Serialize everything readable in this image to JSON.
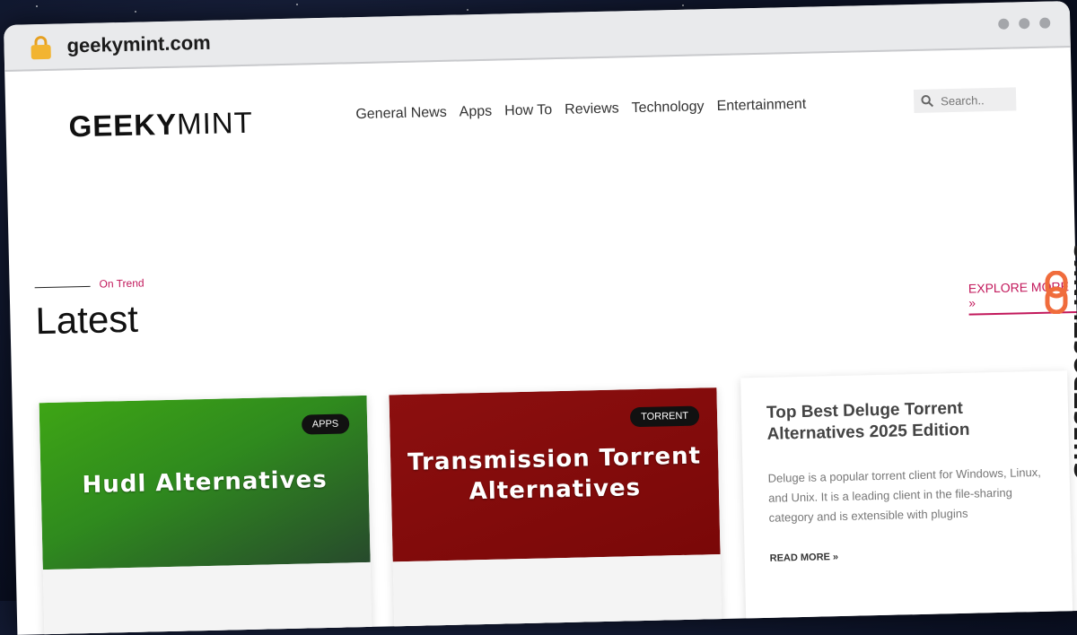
{
  "browser": {
    "url": "geekymint.com"
  },
  "header": {
    "logo_bold": "GEEKY",
    "logo_thin": "MINT",
    "nav": [
      "General News",
      "Apps",
      "How To",
      "Reviews",
      "Technology",
      "Entertainment"
    ],
    "search_placeholder": "Search.."
  },
  "section": {
    "kicker": "On Trend",
    "title": "Latest",
    "explore": "EXPLORE MORE »"
  },
  "cards": [
    {
      "badge": "APPS",
      "thumb_line1": "Hudl Alternatives",
      "thumb_line2": ""
    },
    {
      "badge": "TORRENT",
      "thumb_line1": "Transmission Torrent",
      "thumb_line2": "Alternatives"
    }
  ],
  "feature": {
    "title": "Top Best Deluge Torrent Alternatives 2025 Edition",
    "excerpt": "Deluge is a popular torrent client for Windows, Linux, and Unix. It is a leading client in the file-sharing category and is extensible with plugins",
    "read_more": "READ MORE »"
  },
  "watermark": {
    "text": "GUESTPOSTLINKS"
  },
  "colors": {
    "accent": "#c2185b",
    "card1_bg": "#3ea515",
    "card2_bg": "#8c0f0f"
  }
}
